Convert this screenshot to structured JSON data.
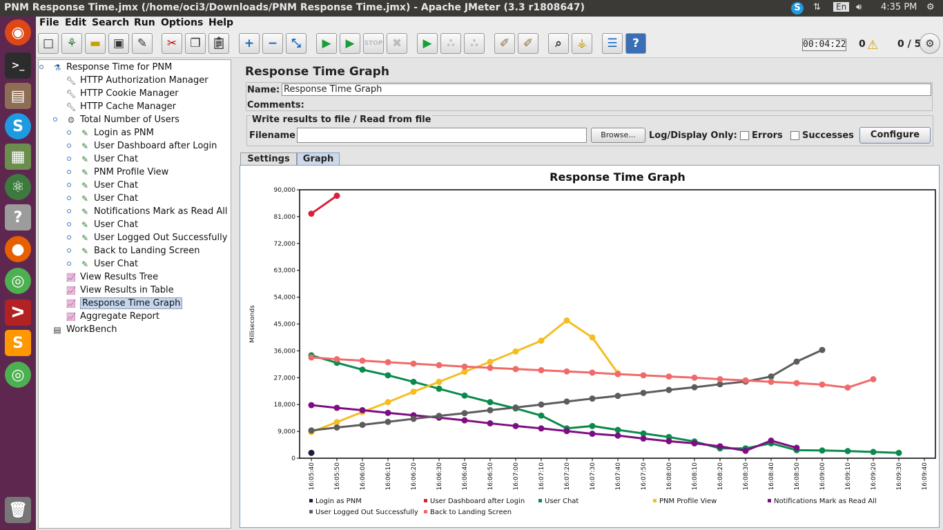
{
  "window_title": "PNM Response Time.jmx (/home/oci3/Downloads/PNM Response Time.jmx) - Apache JMeter (3.3 r1808647)",
  "tray": {
    "lang": "En",
    "time": "4:35 PM"
  },
  "menu": [
    "File",
    "Edit",
    "Search",
    "Run",
    "Options",
    "Help"
  ],
  "status": {
    "timer": "00:04:22",
    "errors": "0",
    "threads": "0 / 5"
  },
  "tree": [
    {
      "label": "Response Time for PNM",
      "icon": "flask-icon"
    },
    {
      "label": "HTTP Authorization Manager",
      "icon": "wrench-icon"
    },
    {
      "label": "HTTP Cookie Manager",
      "icon": "wrench-icon"
    },
    {
      "label": "HTTP Cache Manager",
      "icon": "wrench-icon"
    },
    {
      "label": "Total Number of Users",
      "icon": "gear-icon"
    },
    {
      "label": "Login as PNM",
      "icon": "sampler-icon"
    },
    {
      "label": "User Dashboard after Login",
      "icon": "sampler-icon"
    },
    {
      "label": "User Chat",
      "icon": "sampler-icon"
    },
    {
      "label": "PNM Profile View",
      "icon": "sampler-icon"
    },
    {
      "label": "User Chat",
      "icon": "sampler-icon"
    },
    {
      "label": "User Chat",
      "icon": "sampler-icon"
    },
    {
      "label": "Notifications Mark as Read All",
      "icon": "sampler-icon"
    },
    {
      "label": "User Chat",
      "icon": "sampler-icon"
    },
    {
      "label": "User Logged Out Successfully",
      "icon": "sampler-icon"
    },
    {
      "label": "Back to Landing Screen",
      "icon": "sampler-icon"
    },
    {
      "label": "User Chat",
      "icon": "sampler-icon"
    },
    {
      "label": "View Results Tree",
      "icon": "listener-icon"
    },
    {
      "label": "View Results in Table",
      "icon": "listener-icon"
    },
    {
      "label": "Response Time Graph",
      "icon": "listener-icon",
      "selected": true
    },
    {
      "label": "Aggregate Report",
      "icon": "listener-icon"
    },
    {
      "label": "WorkBench",
      "icon": "workbench-icon"
    }
  ],
  "panel": {
    "title": "Response Time Graph",
    "name_label": "Name:",
    "name_value": "Response Time Graph",
    "comments_label": "Comments:",
    "group_title": "Write results to file / Read from file",
    "filename_label": "Filename",
    "browse_label": "Browse...",
    "log_display_label": "Log/Display Only:",
    "errors_label": "Errors",
    "successes_label": "Successes",
    "configure_label": "Configure",
    "tabs": [
      "Settings",
      "Graph"
    ]
  },
  "chart_data": {
    "type": "line",
    "title": "Response Time Graph",
    "ylabel": "Milliseconds",
    "ylim": [
      0,
      90000
    ],
    "yticks": [
      "0",
      "9,000",
      "18,000",
      "27,000",
      "36,000",
      "45,000",
      "54,000",
      "63,000",
      "72,000",
      "81,000",
      "90,000"
    ],
    "categories": [
      "16:05:40",
      "16:05:50",
      "16:06:00",
      "16:06:10",
      "16:06:20",
      "16:06:30",
      "16:06:40",
      "16:06:50",
      "16:07:00",
      "16:07:10",
      "16:07:20",
      "16:07:30",
      "16:07:40",
      "16:07:50",
      "16:08:00",
      "16:08:10",
      "16:08:20",
      "16:08:30",
      "16:08:40",
      "16:08:50",
      "16:09:00",
      "16:09:10",
      "16:09:20",
      "16:09:30",
      "16:09:40"
    ],
    "series": [
      {
        "name": "Login as PNM",
        "color": "#1c1c3c",
        "values": [
          1800,
          null,
          null,
          null,
          null,
          null,
          null,
          null,
          null,
          null,
          null,
          null,
          null,
          null,
          null,
          null,
          null,
          null,
          null,
          null,
          null,
          null,
          null,
          null,
          null
        ]
      },
      {
        "name": "User Dashboard after Login",
        "color": "#d8203c",
        "values": [
          82000,
          88000,
          null,
          null,
          null,
          null,
          null,
          null,
          null,
          null,
          null,
          null,
          null,
          null,
          null,
          null,
          null,
          null,
          null,
          null,
          null,
          null,
          null,
          null,
          null
        ]
      },
      {
        "name": "User Chat",
        "color": "#0a8a4c",
        "values": [
          34500,
          32000,
          29700,
          27800,
          25600,
          23300,
          21000,
          18800,
          16700,
          14300,
          10000,
          10800,
          9500,
          8300,
          7100,
          5600,
          3300,
          3300,
          5000,
          2700,
          2600,
          2400,
          2100,
          1800,
          null
        ]
      },
      {
        "name": "PNM Profile View",
        "color": "#f5bd22",
        "values": [
          8800,
          12100,
          15500,
          18800,
          22300,
          25600,
          29000,
          32300,
          35800,
          39400,
          46200,
          40500,
          28500,
          null,
          null,
          null,
          null,
          null,
          null,
          null,
          null,
          null,
          null,
          null,
          null
        ]
      },
      {
        "name": "Notifications Mark as Read All",
        "color": "#7f0d82",
        "values": [
          17800,
          16900,
          16100,
          15200,
          14400,
          13600,
          12700,
          11700,
          10800,
          10000,
          9100,
          8200,
          7600,
          6600,
          5700,
          5000,
          4000,
          2500,
          5900,
          3500,
          null,
          null,
          null,
          null,
          null
        ]
      },
      {
        "name": "User Logged Out Successfully",
        "color": "#5c5c5c",
        "values": [
          9300,
          10300,
          11200,
          12200,
          13200,
          14200,
          15100,
          16100,
          17000,
          18000,
          19000,
          20000,
          20900,
          21900,
          22900,
          23800,
          24800,
          25700,
          27400,
          32400,
          36300,
          null,
          null,
          null,
          null
        ]
      },
      {
        "name": "Back to Landing Screen",
        "color": "#f06a6a",
        "values": [
          33800,
          33200,
          32700,
          32200,
          31700,
          31200,
          30700,
          30300,
          29900,
          29500,
          29100,
          28700,
          28200,
          27800,
          27400,
          27000,
          26500,
          26100,
          25600,
          25200,
          24700,
          23700,
          26500,
          null,
          null
        ]
      }
    ]
  }
}
